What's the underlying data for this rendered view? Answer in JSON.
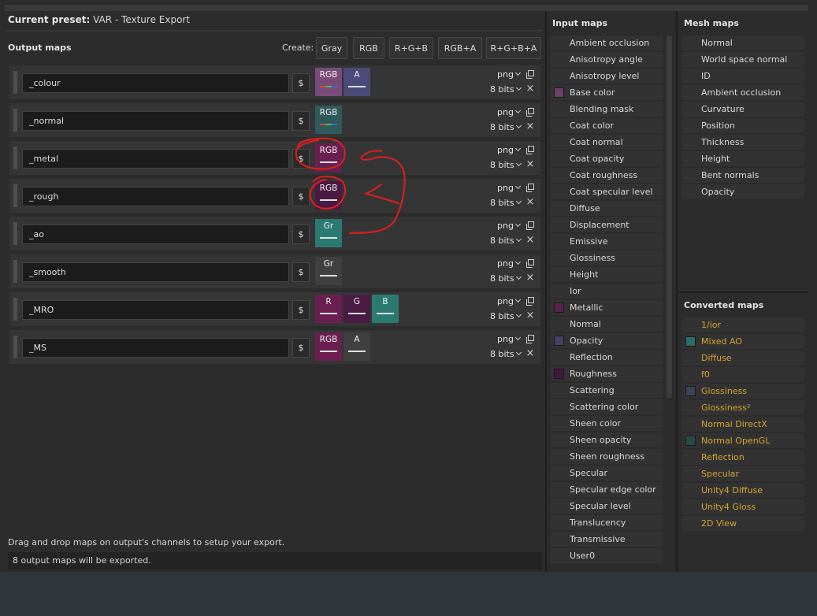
{
  "preset": {
    "label": "Current preset:",
    "value": "VAR - Texture Export"
  },
  "output_maps": {
    "title": "Output maps",
    "create_label": "Create:",
    "create_buttons": [
      "Gray",
      "RGB",
      "R+G+B",
      "RGB+A",
      "R+G+B+A"
    ],
    "rows": [
      {
        "name": "_colour",
        "format": "png",
        "bits": "8 bits",
        "channels": [
          {
            "label": "RGB",
            "color": "#7a4b78",
            "bar": "rgb"
          },
          {
            "label": "A",
            "color": "#4b4a7a",
            "bar": "white"
          }
        ]
      },
      {
        "name": "_normal",
        "format": "png",
        "bits": "8 bits",
        "channels": [
          {
            "label": "RGB",
            "color": "#2f5a5c",
            "bar": "rgb"
          }
        ]
      },
      {
        "name": "_metal",
        "format": "png",
        "bits": "8 bits",
        "channels": [
          {
            "label": "RGB",
            "color": "#6a1f50",
            "bar": "white"
          }
        ]
      },
      {
        "name": "_rough",
        "format": "png",
        "bits": "8 bits",
        "channels": [
          {
            "label": "RGB",
            "color": "#4a1a44",
            "bar": "white"
          }
        ]
      },
      {
        "name": "_ao",
        "format": "png",
        "bits": "8 bits",
        "channels": [
          {
            "label": "Gr",
            "color": "#2b7a72",
            "bar": "white"
          }
        ]
      },
      {
        "name": "_smooth",
        "format": "png",
        "bits": "8 bits",
        "channels": [
          {
            "label": "Gr",
            "color": "#404040",
            "bar": "white"
          }
        ]
      },
      {
        "name": "_MRO",
        "format": "png",
        "bits": "8 bits",
        "channels": [
          {
            "label": "R",
            "color": "#6a1f50",
            "bar": "white"
          },
          {
            "label": "G",
            "color": "#4a1a44",
            "bar": "white"
          },
          {
            "label": "B",
            "color": "#2b7a72",
            "bar": "white"
          }
        ]
      },
      {
        "name": "_MS",
        "format": "png",
        "bits": "8 bits",
        "channels": [
          {
            "label": "RGB",
            "color": "#6a1f50",
            "bar": "white"
          },
          {
            "label": "A",
            "color": "#404040",
            "bar": "white"
          }
        ]
      }
    ],
    "dollar_label": "$",
    "hint": "Drag and drop maps on output's channels to setup your export.",
    "status": "8 output maps will be exported."
  },
  "input_maps": {
    "title": "Input maps",
    "items": [
      {
        "label": "Ambient occlusion"
      },
      {
        "label": "Anisotropy angle"
      },
      {
        "label": "Anisotropy level"
      },
      {
        "label": "Base color",
        "swatch": "#6e3f6c"
      },
      {
        "label": "Blending mask"
      },
      {
        "label": "Coat color"
      },
      {
        "label": "Coat normal"
      },
      {
        "label": "Coat opacity"
      },
      {
        "label": "Coat roughness"
      },
      {
        "label": "Coat specular level"
      },
      {
        "label": "Diffuse"
      },
      {
        "label": "Displacement"
      },
      {
        "label": "Emissive"
      },
      {
        "label": "Glossiness"
      },
      {
        "label": "Height"
      },
      {
        "label": "Ior"
      },
      {
        "label": "Metallic",
        "swatch": "#5a2150"
      },
      {
        "label": "Normal"
      },
      {
        "label": "Opacity",
        "swatch": "#41416b"
      },
      {
        "label": "Reflection"
      },
      {
        "label": "Roughness",
        "swatch": "#41173e"
      },
      {
        "label": "Scattering"
      },
      {
        "label": "Scattering color"
      },
      {
        "label": "Sheen color"
      },
      {
        "label": "Sheen opacity"
      },
      {
        "label": "Sheen roughness"
      },
      {
        "label": "Specular"
      },
      {
        "label": "Specular edge color"
      },
      {
        "label": "Specular level"
      },
      {
        "label": "Translucency"
      },
      {
        "label": "Transmissive"
      },
      {
        "label": "User0"
      }
    ]
  },
  "mesh_maps": {
    "title": "Mesh maps",
    "items": [
      "Normal",
      "World space normal",
      "ID",
      "Ambient occlusion",
      "Curvature",
      "Position",
      "Thickness",
      "Height",
      "Bent normals",
      "Opacity"
    ]
  },
  "converted_maps": {
    "title": "Converted maps",
    "items": [
      {
        "label": "1/ior"
      },
      {
        "label": "Mixed AO",
        "swatch": "#2a6e6a"
      },
      {
        "label": "Diffuse"
      },
      {
        "label": "f0"
      },
      {
        "label": "Glossiness",
        "swatch": "#3a4656"
      },
      {
        "label": "Glossiness²"
      },
      {
        "label": "Normal DirectX"
      },
      {
        "label": "Normal OpenGL",
        "swatch": "#264a48"
      },
      {
        "label": "Reflection"
      },
      {
        "label": "Specular"
      },
      {
        "label": "Unity4 Diffuse"
      },
      {
        "label": "Unity4 Gloss"
      },
      {
        "label": "2D View"
      }
    ]
  }
}
